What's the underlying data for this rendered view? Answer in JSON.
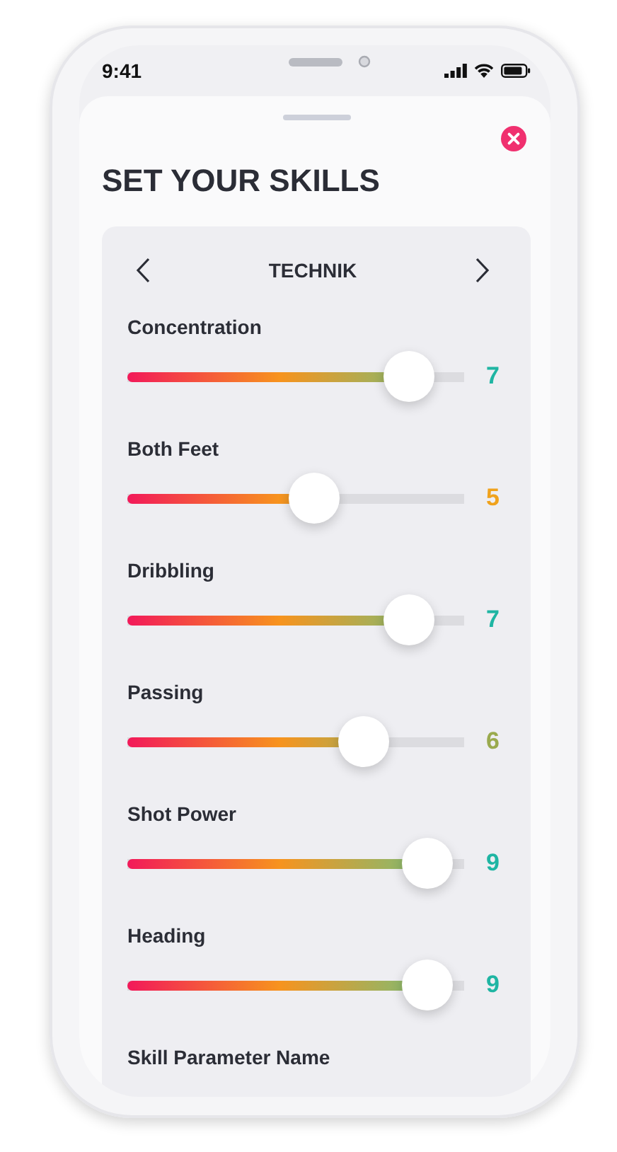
{
  "status_bar": {
    "time": "9:41"
  },
  "title": "SET YOUR SKILLS",
  "category": {
    "label": "TECHNIK"
  },
  "skills": [
    {
      "name": "Concentration",
      "level": 0.835,
      "value": "7",
      "color": "#1fb5a3"
    },
    {
      "name": "Both Feet",
      "level": 0.555,
      "value": "5",
      "color": "#f0a21c"
    },
    {
      "name": "Dribbling",
      "level": 0.835,
      "value": "7",
      "color": "#1fb5a3"
    },
    {
      "name": "Passing",
      "level": 0.7,
      "value": "6",
      "color": "#9aaa4e"
    },
    {
      "name": "Shot Power",
      "level": 0.89,
      "value": "9",
      "color": "#1fb5a3"
    },
    {
      "name": "Heading",
      "level": 0.89,
      "value": "9",
      "color": "#1fb5a3"
    }
  ],
  "next_label": "Skill Parameter Name"
}
